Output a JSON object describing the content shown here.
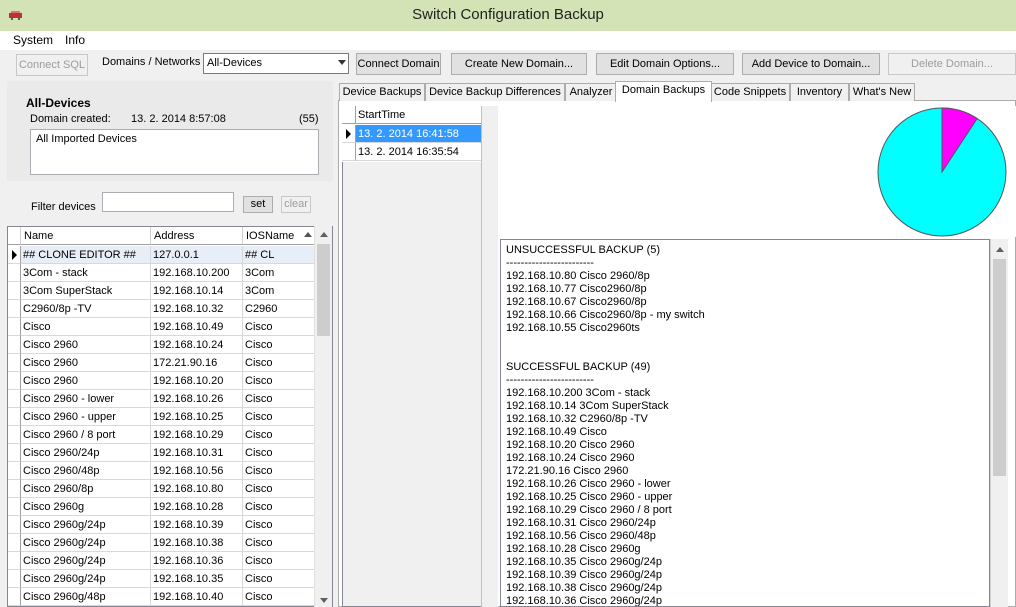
{
  "window": {
    "title": "Switch Configuration Backup"
  },
  "menu": {
    "system": "System",
    "info": "Info"
  },
  "toolbar": {
    "connect_sql": "Connect SQL",
    "domains_label": "Domains / Networks",
    "domain_selected": "All-Devices",
    "connect_domain": "Connect Domain",
    "create_domain": "Create New Domain...",
    "edit_domain": "Edit Domain Options...",
    "add_device": "Add Device to Domain...",
    "delete_domain": "Delete Domain..."
  },
  "domain": {
    "name": "All-Devices",
    "created_label": "Domain created:",
    "created_value": "13. 2. 2014 8:57:08",
    "count": "(55)",
    "description": "All Imported Devices"
  },
  "filter": {
    "label": "Filter devices",
    "value": "",
    "set": "set",
    "clear": "clear"
  },
  "devices": {
    "headers": {
      "name": "Name",
      "address": "Address",
      "ios": "IOSName"
    },
    "rows": [
      {
        "name": "## CLONE EDITOR ##",
        "address": "127.0.0.1",
        "ios": "## CL"
      },
      {
        "name": "3Com - stack",
        "address": "192.168.10.200",
        "ios": "3Com"
      },
      {
        "name": "3Com SuperStack",
        "address": "192.168.10.14",
        "ios": "3Com"
      },
      {
        "name": "C2960/8p -TV",
        "address": "192.168.10.32",
        "ios": "C2960"
      },
      {
        "name": "Cisco",
        "address": "192.168.10.49",
        "ios": "Cisco"
      },
      {
        "name": "Cisco 2960",
        "address": "192.168.10.24",
        "ios": "Cisco"
      },
      {
        "name": "Cisco 2960",
        "address": "172.21.90.16",
        "ios": "Cisco"
      },
      {
        "name": "Cisco 2960",
        "address": "192.168.10.20",
        "ios": "Cisco"
      },
      {
        "name": "Cisco 2960 - lower",
        "address": "192.168.10.26",
        "ios": "Cisco"
      },
      {
        "name": "Cisco 2960 - upper",
        "address": "192.168.10.25",
        "ios": "Cisco"
      },
      {
        "name": "Cisco 2960 / 8 port",
        "address": "192.168.10.29",
        "ios": "Cisco"
      },
      {
        "name": "Cisco 2960/24p",
        "address": "192.168.10.31",
        "ios": "Cisco"
      },
      {
        "name": "Cisco 2960/48p",
        "address": "192.168.10.56",
        "ios": "Cisco"
      },
      {
        "name": "Cisco 2960/8p",
        "address": "192.168.10.80",
        "ios": "Cisco"
      },
      {
        "name": "Cisco 2960g",
        "address": "192.168.10.28",
        "ios": "Cisco"
      },
      {
        "name": "Cisco 2960g/24p",
        "address": "192.168.10.39",
        "ios": "Cisco"
      },
      {
        "name": "Cisco 2960g/24p",
        "address": "192.168.10.38",
        "ios": "Cisco"
      },
      {
        "name": "Cisco 2960g/24p",
        "address": "192.168.10.36",
        "ios": "Cisco"
      },
      {
        "name": "Cisco 2960g/24p",
        "address": "192.168.10.35",
        "ios": "Cisco"
      },
      {
        "name": "Cisco 2960g/48p",
        "address": "192.168.10.40",
        "ios": "Cisco"
      }
    ]
  },
  "tabs": [
    "Device Backups",
    "Device Backup Differences",
    "Analyzer",
    "Domain Backups",
    "Code Snippets",
    "Inventory",
    "What's New"
  ],
  "active_tab": "Domain Backups",
  "backups": {
    "header": "StartTime",
    "rows": [
      "13. 2. 2014 16:41:58",
      "13. 2. 2014 16:35:54"
    ]
  },
  "pie": {
    "successful": 49,
    "unsuccessful": 5,
    "colors": {
      "successful": "#00ffff",
      "unsuccessful": "#ff00ff"
    }
  },
  "report": {
    "lines": [
      "UNSUCCESSFUL BACKUP (5)",
      "------------------------",
      "192.168.10.80 Cisco 2960/8p",
      "192.168.10.77 Cisco2960/8p",
      "192.168.10.67 Cisco2960/8p",
      "192.168.10.66 Cisco2960/8p - my switch",
      "192.168.10.55 Cisco2960ts",
      "",
      "",
      "SUCCESSFUL BACKUP (49)",
      "------------------------",
      "192.168.10.200 3Com - stack",
      "192.168.10.14 3Com SuperStack",
      "192.168.10.32 C2960/8p -TV",
      "192.168.10.49 Cisco",
      "192.168.10.20 Cisco 2960",
      "192.168.10.24 Cisco 2960",
      "172.21.90.16 Cisco 2960",
      "192.168.10.26 Cisco 2960 - lower",
      "192.168.10.25 Cisco 2960 - upper",
      "192.168.10.29 Cisco 2960 / 8 port",
      "192.168.10.31 Cisco 2960/24p",
      "192.168.10.56 Cisco 2960/48p",
      "192.168.10.28 Cisco 2960g",
      "192.168.10.35 Cisco 2960g/24p",
      "192.168.10.39 Cisco 2960g/24p",
      "192.168.10.38 Cisco 2960g/24p",
      "192.168.10.36 Cisco 2960g/24p"
    ]
  }
}
